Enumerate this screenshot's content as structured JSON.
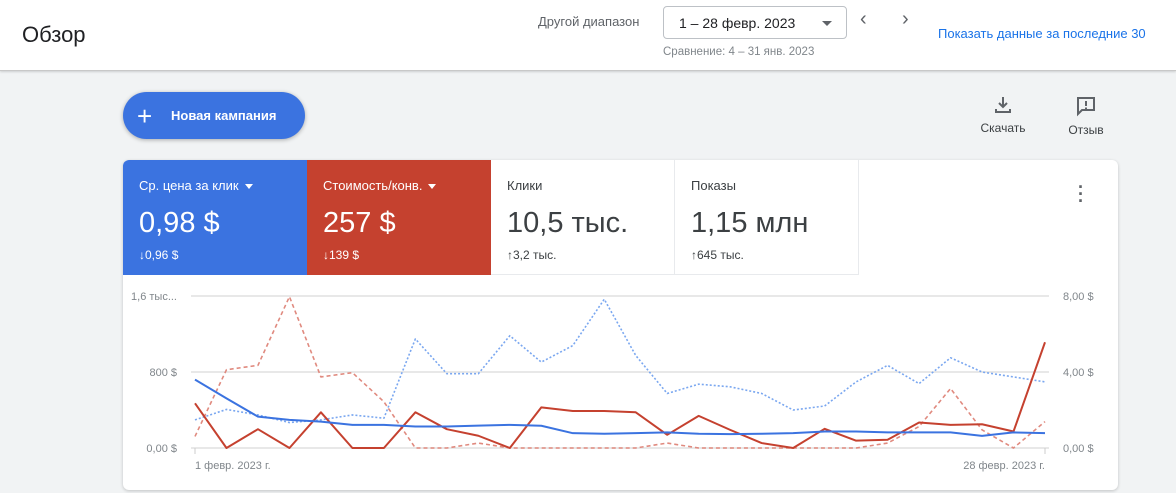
{
  "header": {
    "title": "Обзор",
    "range_label": "Другой диапазон",
    "range_value": "1 – 28 февр. 2023",
    "compare": "Сравнение: 4 – 31 янв. 2023",
    "link": "Показать данные за последние 30"
  },
  "toolbar": {
    "new_campaign": "Новая кампания",
    "download": "Скачать",
    "feedback": "Отзыв"
  },
  "colors": {
    "blue": "#3b73e0",
    "red": "#c5412f",
    "blue_prev": "#7aa7f0",
    "red_prev": "#e08a7f"
  },
  "metrics": [
    {
      "name": "Ср. цена за клик",
      "value": "0,98 $",
      "delta": "↓0,96 $",
      "selected": true,
      "color": "#3b73e0"
    },
    {
      "name": "Стоимость/конв.",
      "value": "257 $",
      "delta": "↓139 $",
      "selected": true,
      "color": "#c5412f"
    },
    {
      "name": "Клики",
      "value": "10,5 тыс.",
      "delta": "↑3,2 тыс.",
      "selected": false
    },
    {
      "name": "Показы",
      "value": "1,15 млн",
      "delta": "↑645 тыс.",
      "selected": false
    }
  ],
  "chart_data": {
    "type": "line",
    "x_labels": [
      "1 февр. 2023 г.",
      "28 февр. 2023 г."
    ],
    "x": [
      1,
      2,
      3,
      4,
      5,
      6,
      7,
      8,
      9,
      10,
      11,
      12,
      13,
      14,
      15,
      16,
      17,
      18,
      19,
      20,
      21,
      22,
      23,
      24,
      25,
      26,
      27,
      28
    ],
    "left_axis": {
      "ticks": [
        "0,00 $",
        "800 $",
        "1,6 тыс..."
      ],
      "ylim": [
        0,
        1600
      ]
    },
    "right_axis": {
      "ticks": [
        "0,00 $",
        "4,00 $",
        "8,00 $"
      ],
      "ylim": [
        0,
        8
      ]
    },
    "grid": true,
    "series": [
      {
        "metric": "Стоимость/конв.",
        "axis": "left",
        "style": "solid",
        "color": "#c5412f",
        "values": [
          470,
          0,
          198,
          0,
          376,
          0,
          0,
          376,
          198,
          129,
          0,
          428,
          390,
          390,
          376,
          139,
          338,
          191,
          52,
          0,
          202,
          77,
          87,
          268,
          243,
          250,
          174,
          1113
        ]
      },
      {
        "metric": "Стоимость/конв. (сравнение)",
        "axis": "left",
        "style": "dashed",
        "color": "#e08a7f",
        "values": [
          122,
          824,
          870,
          1593,
          748,
          793,
          487,
          0,
          0,
          52,
          0,
          0,
          0,
          0,
          0,
          52,
          0,
          0,
          0,
          0,
          0,
          0,
          52,
          226,
          626,
          191,
          0,
          278
        ]
      },
      {
        "metric": "Ср. цена за клик",
        "axis": "right",
        "style": "solid",
        "color": "#3b73e0",
        "values": [
          3.6,
          2.61,
          1.65,
          1.48,
          1.39,
          1.22,
          1.22,
          1.13,
          1.13,
          1.18,
          1.22,
          1.17,
          0.78,
          0.75,
          0.78,
          0.82,
          0.75,
          0.73,
          0.75,
          0.78,
          0.87,
          0.87,
          0.82,
          0.82,
          0.82,
          0.64,
          0.82,
          0.78
        ]
      },
      {
        "metric": "Ср. цена за клик (сравнение)",
        "axis": "right",
        "style": "dotted",
        "color": "#7aa7f0",
        "values": [
          1.48,
          2.03,
          1.74,
          1.34,
          1.48,
          1.74,
          1.57,
          5.74,
          3.91,
          3.91,
          5.91,
          4.52,
          5.39,
          7.83,
          4.87,
          2.87,
          3.36,
          3.22,
          2.87,
          2.0,
          2.21,
          3.48,
          4.35,
          3.39,
          4.75,
          4.0,
          3.74,
          3.48
        ]
      }
    ]
  }
}
